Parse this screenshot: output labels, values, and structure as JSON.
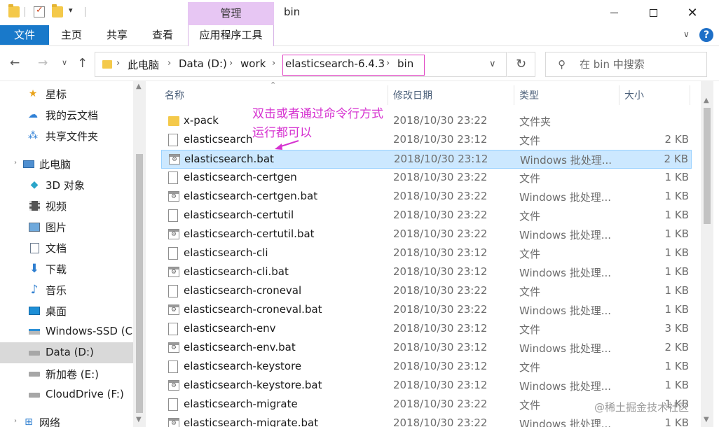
{
  "window": {
    "title": "bin",
    "context_tab_header": "管理"
  },
  "ribbon": {
    "tabs": [
      "文件",
      "主页",
      "共享",
      "查看",
      "应用程序工具"
    ]
  },
  "address": {
    "crumbs": [
      "此电脑",
      "Data (D:)",
      "work",
      "elasticsearch-6.4.3",
      "bin"
    ],
    "search_placeholder": "在 bin 中搜索"
  },
  "nav_pane": {
    "items": [
      {
        "label": "星标",
        "icon": "star-icon"
      },
      {
        "label": "我的云文档",
        "icon": "cloud-icon"
      },
      {
        "label": "共享文件夹",
        "icon": "shared-folder-icon"
      },
      {
        "label": "此电脑",
        "icon": "computer-icon"
      },
      {
        "label": "3D 对象",
        "icon": "cube-icon"
      },
      {
        "label": "视频",
        "icon": "video-icon"
      },
      {
        "label": "图片",
        "icon": "picture-icon"
      },
      {
        "label": "文档",
        "icon": "document-icon"
      },
      {
        "label": "下载",
        "icon": "download-icon"
      },
      {
        "label": "音乐",
        "icon": "music-icon"
      },
      {
        "label": "桌面",
        "icon": "desktop-icon"
      },
      {
        "label": "Windows-SSD (C:",
        "icon": "drive-c-icon"
      },
      {
        "label": "Data (D:)",
        "icon": "drive-icon",
        "selected": true
      },
      {
        "label": "新加卷 (E:)",
        "icon": "drive-icon"
      },
      {
        "label": "CloudDrive (F:)",
        "icon": "drive-icon"
      },
      {
        "label": "网络",
        "icon": "network-icon"
      }
    ]
  },
  "columns": {
    "name": "名称",
    "date": "修改日期",
    "type": "类型",
    "size": "大小"
  },
  "files": [
    {
      "name": "x-pack",
      "date": "2018/10/30 23:22",
      "type": "文件夹",
      "size": "",
      "kind": "folder"
    },
    {
      "name": "elasticsearch",
      "date": "2018/10/30 23:12",
      "type": "文件",
      "size": "2 KB",
      "kind": "file"
    },
    {
      "name": "elasticsearch.bat",
      "date": "2018/10/30 23:12",
      "type": "Windows 批处理...",
      "size": "2 KB",
      "kind": "bat",
      "selected": true
    },
    {
      "name": "elasticsearch-certgen",
      "date": "2018/10/30 23:22",
      "type": "文件",
      "size": "1 KB",
      "kind": "file"
    },
    {
      "name": "elasticsearch-certgen.bat",
      "date": "2018/10/30 23:22",
      "type": "Windows 批处理...",
      "size": "1 KB",
      "kind": "bat"
    },
    {
      "name": "elasticsearch-certutil",
      "date": "2018/10/30 23:22",
      "type": "文件",
      "size": "1 KB",
      "kind": "file"
    },
    {
      "name": "elasticsearch-certutil.bat",
      "date": "2018/10/30 23:22",
      "type": "Windows 批处理...",
      "size": "1 KB",
      "kind": "bat"
    },
    {
      "name": "elasticsearch-cli",
      "date": "2018/10/30 23:12",
      "type": "文件",
      "size": "1 KB",
      "kind": "file"
    },
    {
      "name": "elasticsearch-cli.bat",
      "date": "2018/10/30 23:12",
      "type": "Windows 批处理...",
      "size": "1 KB",
      "kind": "bat"
    },
    {
      "name": "elasticsearch-croneval",
      "date": "2018/10/30 23:22",
      "type": "文件",
      "size": "1 KB",
      "kind": "file"
    },
    {
      "name": "elasticsearch-croneval.bat",
      "date": "2018/10/30 23:22",
      "type": "Windows 批处理...",
      "size": "1 KB",
      "kind": "bat"
    },
    {
      "name": "elasticsearch-env",
      "date": "2018/10/30 23:12",
      "type": "文件",
      "size": "3 KB",
      "kind": "file"
    },
    {
      "name": "elasticsearch-env.bat",
      "date": "2018/10/30 23:12",
      "type": "Windows 批处理...",
      "size": "2 KB",
      "kind": "bat"
    },
    {
      "name": "elasticsearch-keystore",
      "date": "2018/10/30 23:12",
      "type": "文件",
      "size": "1 KB",
      "kind": "file"
    },
    {
      "name": "elasticsearch-keystore.bat",
      "date": "2018/10/30 23:12",
      "type": "Windows 批处理...",
      "size": "1 KB",
      "kind": "bat"
    },
    {
      "name": "elasticsearch-migrate",
      "date": "2018/10/30 23:22",
      "type": "文件",
      "size": "1 KB",
      "kind": "file"
    },
    {
      "name": "elasticsearch-migrate.bat",
      "date": "2018/10/30 23:22",
      "type": "Windows 批处理...",
      "size": "1 KB",
      "kind": "bat"
    }
  ],
  "annotation": {
    "line1": "双击或者通过命令行方式",
    "line2": "运行都可以",
    "color": "#d633d0"
  },
  "watermark": "@稀土掘金技术社区",
  "colors": {
    "file_tab": "#1979ca",
    "context_tab": "#e7c6f3",
    "selection": "#cce8ff",
    "crumb_highlight": "#e042c2"
  }
}
